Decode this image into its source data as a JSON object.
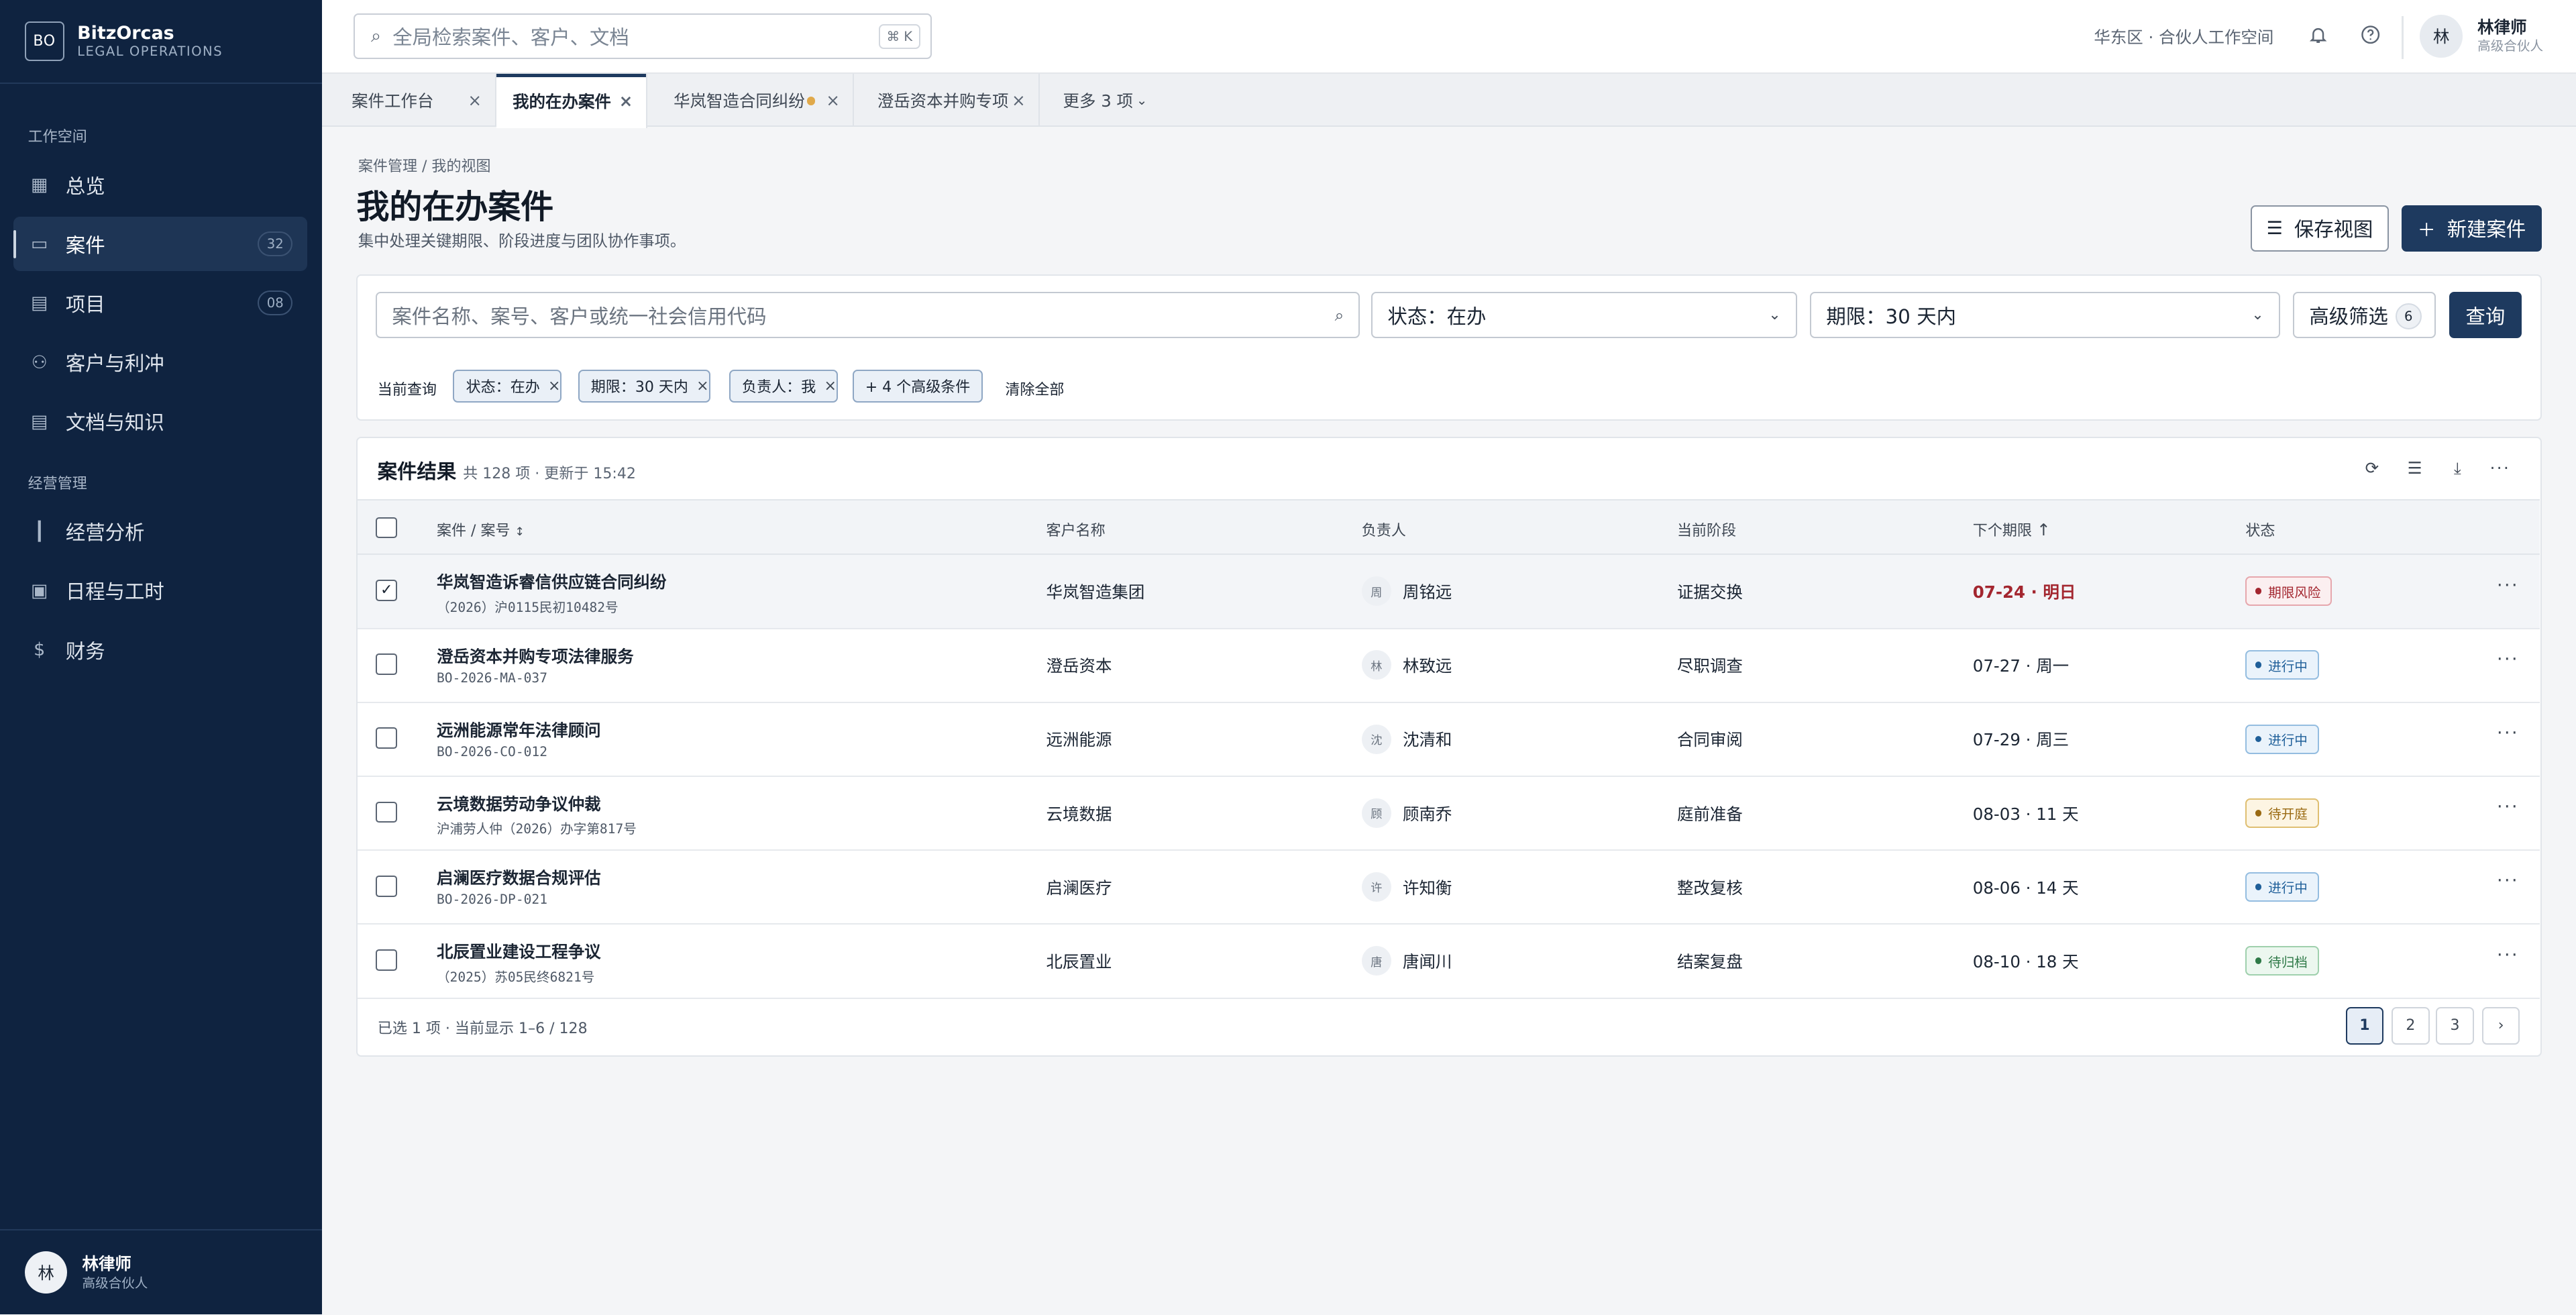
{
  "brand": {
    "mark": "BO",
    "name": "BitzOrcas",
    "subtitle": "LEGAL OPERATIONS"
  },
  "sidebar": {
    "sections": [
      {
        "label": "工作空间",
        "items": [
          {
            "label": "总览",
            "icon": "grid-icon",
            "glyph": "▦",
            "badge": null,
            "active": false
          },
          {
            "label": "案件",
            "icon": "briefcase-icon",
            "glyph": "▭",
            "badge": "32",
            "active": true
          },
          {
            "label": "项目",
            "icon": "clipboard-icon",
            "glyph": "▤",
            "badge": "08",
            "active": false
          },
          {
            "label": "客户与利冲",
            "icon": "user-plus-icon",
            "glyph": "⚇",
            "badge": null,
            "active": false
          },
          {
            "label": "文档与知识",
            "icon": "document-icon",
            "glyph": "▤",
            "badge": null,
            "active": false
          }
        ]
      },
      {
        "label": "经营管理",
        "items": [
          {
            "label": "经营分析",
            "icon": "bar-chart-icon",
            "glyph": "┃",
            "badge": null,
            "active": false
          },
          {
            "label": "日程与工时",
            "icon": "calendar-icon",
            "glyph": "▣",
            "badge": null,
            "active": false
          },
          {
            "label": "财务",
            "icon": "currency-icon",
            "glyph": "$",
            "badge": null,
            "active": false
          }
        ]
      }
    ],
    "user": {
      "avatar": "林",
      "name": "林律师",
      "role": "高级合伙人"
    }
  },
  "topbar": {
    "search_placeholder": "全局检索案件、客户、文档",
    "search_shortcut": "⌘ K",
    "workspace": "华东区 · 合伙人工作空间",
    "user": {
      "avatar": "林",
      "name": "林律师",
      "role": "高级合伙人"
    }
  },
  "tabs": [
    {
      "label": "案件工作台",
      "closable": true,
      "active": false,
      "dirty": false
    },
    {
      "label": "我的在办案件",
      "closable": true,
      "active": true,
      "dirty": false
    },
    {
      "label": "华岚智造合同纠纷",
      "closable": true,
      "active": false,
      "dirty": true
    },
    {
      "label": "澄岳资本并购专项",
      "closable": true,
      "active": false,
      "dirty": false
    },
    {
      "label": "更多 3 项",
      "closable": false,
      "active": false,
      "dirty": false
    }
  ],
  "page": {
    "breadcrumb": "案件管理 / 我的视图",
    "title": "我的在办案件",
    "subtitle": "集中处理关键期限、阶段进度与团队协作事项。",
    "save_view": "保存视图",
    "new_case": "新建案件"
  },
  "filters": {
    "search_placeholder": "案件名称、案号、客户或统一社会信用代码",
    "status": "状态：在办",
    "deadline": "期限：30 天内",
    "advanced": "高级筛选",
    "advanced_count": "6",
    "query": "查询",
    "current_label": "当前查询",
    "chips": [
      "状态：在办",
      "期限：30 天内",
      "负责人：我"
    ],
    "extra_chip": "+ 4 个高级条件",
    "clear_all": "清除全部"
  },
  "results": {
    "title": "案件结果",
    "meta": "共 128 项 · 更新于 15:42",
    "columns": {
      "case": "案件 / 案号",
      "client": "客户名称",
      "owner": "负责人",
      "stage": "当前阶段",
      "deadline": "下个期限",
      "status": "状态"
    },
    "rows": [
      {
        "name": "华岚智造诉睿信供应链合同纠纷",
        "no": "（2026）沪0115民初10482号",
        "client": "华岚智造集团",
        "owner_avatar": "周",
        "owner": "周铭远",
        "stage": "证据交换",
        "deadline": "07-24 · 明日",
        "urgent": true,
        "status": "期限风险",
        "status_kind": "risk",
        "selected": true
      },
      {
        "name": "澄岳资本并购专项法律服务",
        "no": "BO-2026-MA-037",
        "client": "澄岳资本",
        "owner_avatar": "林",
        "owner": "林致远",
        "stage": "尽职调查",
        "deadline": "07-27 · 周一",
        "urgent": false,
        "status": "进行中",
        "status_kind": "progress",
        "selected": false
      },
      {
        "name": "远洲能源常年法律顾问",
        "no": "BO-2026-CO-012",
        "client": "远洲能源",
        "owner_avatar": "沈",
        "owner": "沈清和",
        "stage": "合同审阅",
        "deadline": "07-29 · 周三",
        "urgent": false,
        "status": "进行中",
        "status_kind": "progress",
        "selected": false
      },
      {
        "name": "云境数据劳动争议仲裁",
        "no": "沪浦劳人仲（2026）办字第817号",
        "client": "云境数据",
        "owner_avatar": "顾",
        "owner": "顾南乔",
        "stage": "庭前准备",
        "deadline": "08-03 · 11 天",
        "urgent": false,
        "status": "待开庭",
        "status_kind": "pending",
        "selected": false
      },
      {
        "name": "启澜医疗数据合规评估",
        "no": "BO-2026-DP-021",
        "client": "启澜医疗",
        "owner_avatar": "许",
        "owner": "许知衡",
        "stage": "整改复核",
        "deadline": "08-06 · 14 天",
        "urgent": false,
        "status": "进行中",
        "status_kind": "progress",
        "selected": false
      },
      {
        "name": "北辰置业建设工程争议",
        "no": "（2025）苏05民终6821号",
        "client": "北辰置业",
        "owner_avatar": "唐",
        "owner": "唐闻川",
        "stage": "结案复盘",
        "deadline": "08-10 · 18 天",
        "urgent": false,
        "status": "待归档",
        "status_kind": "archive",
        "selected": false
      }
    ],
    "footer": "已选 1 项 · 当前显示 1–6 / 128",
    "pages": [
      "1",
      "2",
      "3"
    ],
    "current_page": "1",
    "next_glyph": "›"
  },
  "colors": {
    "sidebar": "#0f2340",
    "primary": "#1e3a5f",
    "risk": "#a3262f",
    "progress": "#1f5f99",
    "pending": "#9a6a12",
    "archive": "#2f7a48"
  }
}
